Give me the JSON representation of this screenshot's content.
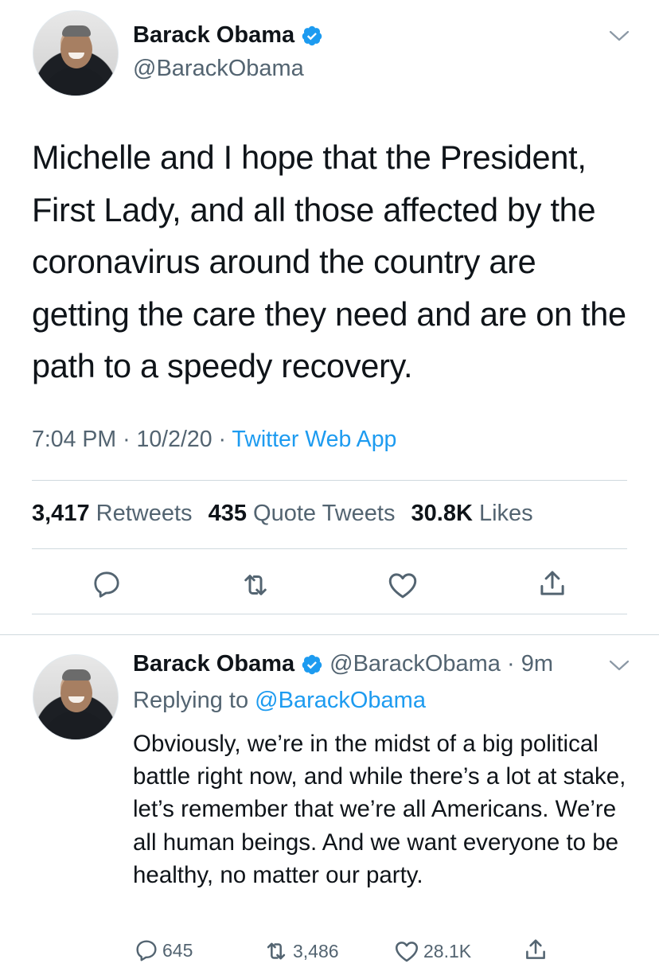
{
  "tweet": {
    "author_name": "Barack Obama",
    "handle": "@BarackObama",
    "text": "Michelle and I hope that the President, First Lady, and all those affected by the coronavirus around the country are getting the care they need and are on the path to a speedy recovery.",
    "time": "7:04 PM",
    "sep1": "·",
    "date": "10/2/20",
    "sep2": "·",
    "source": "Twitter Web App",
    "stats": {
      "retweets_count": "3,417",
      "retweets_label": "Retweets",
      "quotes_count": "435",
      "quotes_label": "Quote Tweets",
      "likes_count": "30.8K",
      "likes_label": "Likes"
    },
    "icons": [
      "reply-icon",
      "retweet-icon",
      "like-icon",
      "share-icon"
    ]
  },
  "reply": {
    "author_name": "Barack Obama",
    "handle_time": "@BarackObama · 9m",
    "replying_prefix": "Replying to",
    "replying_to": "@BarackObama",
    "text": "Obviously, we’re in the midst of a big political battle right now, and while there’s a lot at stake, let’s remember that we’re all Americans. We’re all human beings. And we want everyone to be healthy, no matter our party.",
    "reply_count": "645",
    "retweet_count": "3,486",
    "like_count": "28.1K"
  },
  "colors": {
    "accent": "#1d9bf0",
    "secondary_text": "#536471",
    "divider": "#cfd9de"
  }
}
